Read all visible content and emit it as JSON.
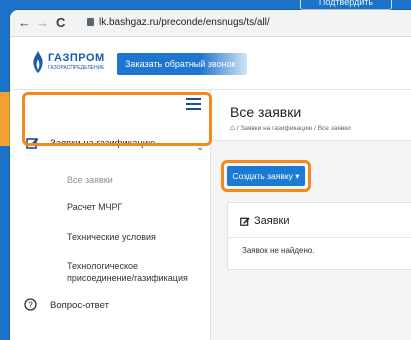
{
  "banner": {
    "button_label": "Подтвердить"
  },
  "browser": {
    "back": "←",
    "forward": "→",
    "reload": "C",
    "url": "lk.bashgaz.ru/preconde/ensnugs/ts/all/"
  },
  "header": {
    "logo_text": "ГАЗПРОМ",
    "logo_subtext": "ГАЗОРАСПРЕДЕЛЕНИЕ",
    "callback_label": "Заказать обратный звонок"
  },
  "sidebar": {
    "items": [
      {
        "label": "Заявки на газификацию",
        "icon": "edit-icon"
      },
      {
        "label": "Все заявки"
      },
      {
        "label": "Расчет МЧРГ"
      },
      {
        "label": "Технические условия"
      },
      {
        "label": "Технологическое присоединение/газификация"
      },
      {
        "label": "Вопрос-ответ",
        "icon": "question-icon"
      }
    ]
  },
  "main": {
    "title": "Все заявки",
    "breadcrumb_sep": "/",
    "breadcrumb_1": "Заявки на газификацию",
    "breadcrumb_2": "Все заявки",
    "create_button": "Создать заявку ▾",
    "card_title": "Заявки",
    "empty_text": "Заявок не найдено."
  },
  "colors": {
    "accent": "#1d7ad4",
    "highlight": "#f08a1c",
    "background": "#1a72c9"
  }
}
